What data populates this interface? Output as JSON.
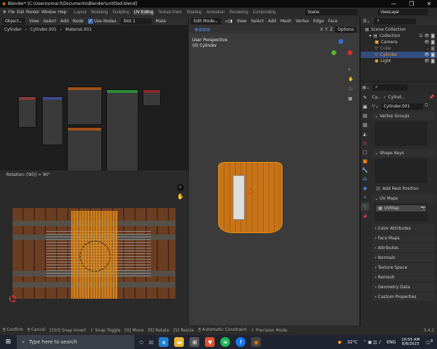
{
  "titlebar": {
    "title": "Blender* [C:\\Users\\omar3\\Documents\\Blender\\untitled.blend]",
    "minimize": "—",
    "maximize": "❐",
    "close": "✕"
  },
  "menubar": {
    "menus": [
      "File",
      "Edit",
      "Render",
      "Window",
      "Help"
    ],
    "workspaces": [
      "Layout",
      "Modeling",
      "Sculpting",
      "UV Editing",
      "Texture Paint",
      "Shading",
      "Animation",
      "Rendering",
      "Compositing"
    ],
    "active_workspace": "UV Editing",
    "scene": "Scene",
    "view_layer": "ViewLayer"
  },
  "node_editor": {
    "object_mode": "Object",
    "menus": [
      "View",
      "Select",
      "Add",
      "Node"
    ],
    "use_nodes": "Use Nodes",
    "slot": "Slot 1",
    "material": "Mate",
    "breadcrumb": [
      "Cylinder",
      "Cylinder.001",
      "Material.001"
    ]
  },
  "uv_editor": {
    "operator_text": "Rotation: [90|] = 90°"
  },
  "viewport": {
    "mode": "Edit Mode",
    "menus": [
      "View",
      "Select",
      "Add",
      "Mesh",
      "Vertex",
      "Edge",
      "Face"
    ],
    "axes": [
      "X",
      "Y",
      "Z"
    ],
    "options": "Options",
    "perspective": "User Perspective",
    "object": "(0) Cylinder"
  },
  "outliner": {
    "search_placeholder": "",
    "root": "Scene Collection",
    "collection": "Collection",
    "items": [
      {
        "name": "Camera",
        "color": "#e8a23c"
      },
      {
        "name": "Cube",
        "color": "#e8a23c"
      },
      {
        "name": "Cylinder",
        "color": "#e8a23c"
      },
      {
        "name": "Light",
        "color": "#e8a23c"
      }
    ]
  },
  "properties": {
    "breadcrumb": [
      "Cy...",
      "Cylind..."
    ],
    "mesh_name": "Cylinder.001",
    "vertex_groups": "Vertex Groups",
    "shape_keys": "Shape Keys",
    "add_rest_position": "Add Rest Position",
    "uv_maps": "UV Maps",
    "uv_map_item": "UVMap",
    "collapsed_panels": [
      "Color Attributes",
      "Face Maps",
      "Attributes",
      "Normals",
      "Texture Space",
      "Remesh",
      "Geometry Data",
      "Custom Properties"
    ]
  },
  "statusbar": {
    "items": [
      "Confirm",
      "Cancel",
      "Snap Invert",
      "Snap Toggle",
      "Move",
      "Rotate",
      "Resize",
      "Automatic Constraint",
      "Precision Mode"
    ],
    "keys": [
      "",
      "",
      "Ctrl",
      "",
      "G",
      "R",
      "S",
      "",
      ""
    ],
    "version": "3.4.1"
  },
  "taskbar": {
    "search_placeholder": "Type here to search",
    "temperature": "32°C",
    "language": "ENG",
    "time": "10:55 AM",
    "date": "6/8/2023",
    "notifications": "8"
  },
  "colors": {
    "accent": "#4772b3",
    "selection": "#e8901a"
  }
}
